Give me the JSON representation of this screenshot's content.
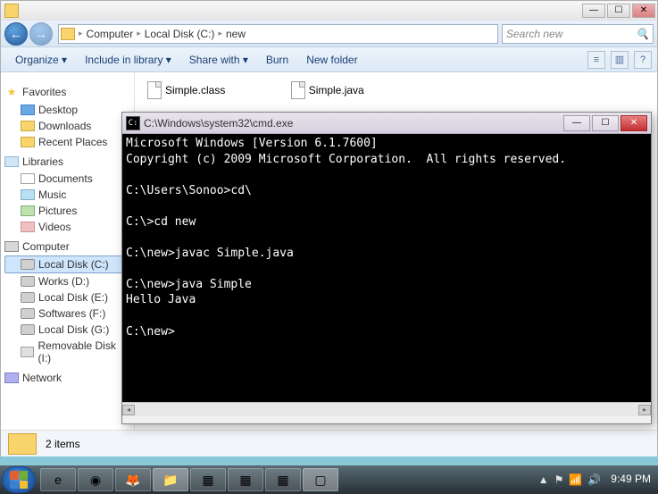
{
  "explorer": {
    "window_title": "",
    "breadcrumb": {
      "root": "Computer",
      "drive": "Local Disk (C:)",
      "folder": "new"
    },
    "search_placeholder": "Search new",
    "toolbar": {
      "organize": "Organize ▾",
      "include": "Include in library ▾",
      "share": "Share with ▾",
      "burn": "Burn",
      "new_folder": "New folder"
    },
    "nav": {
      "favorites": "Favorites",
      "fav_items": [
        "Desktop",
        "Downloads",
        "Recent Places"
      ],
      "libraries": "Libraries",
      "lib_items": [
        "Documents",
        "Music",
        "Pictures",
        "Videos"
      ],
      "computer": "Computer",
      "comp_items": [
        "Local Disk (C:)",
        "Works (D:)",
        "Local Disk (E:)",
        "Softwares (F:)",
        "Local Disk (G:)",
        "Removable Disk (I:)"
      ],
      "network": "Network"
    },
    "files": [
      "Simple.class",
      "Simple.java"
    ],
    "status": "2 items"
  },
  "cmd": {
    "title": "C:\\Windows\\system32\\cmd.exe",
    "lines": [
      "Microsoft Windows [Version 6.1.7600]",
      "Copyright (c) 2009 Microsoft Corporation.  All rights reserved.",
      "",
      "C:\\Users\\Sonoo>cd\\",
      "",
      "C:\\>cd new",
      "",
      "C:\\new>javac Simple.java",
      "",
      "C:\\new>java Simple",
      "Hello Java",
      "",
      "C:\\new>"
    ]
  },
  "taskbar": {
    "time": "9:49 PM",
    "date": "",
    "tray_up": "▲"
  }
}
